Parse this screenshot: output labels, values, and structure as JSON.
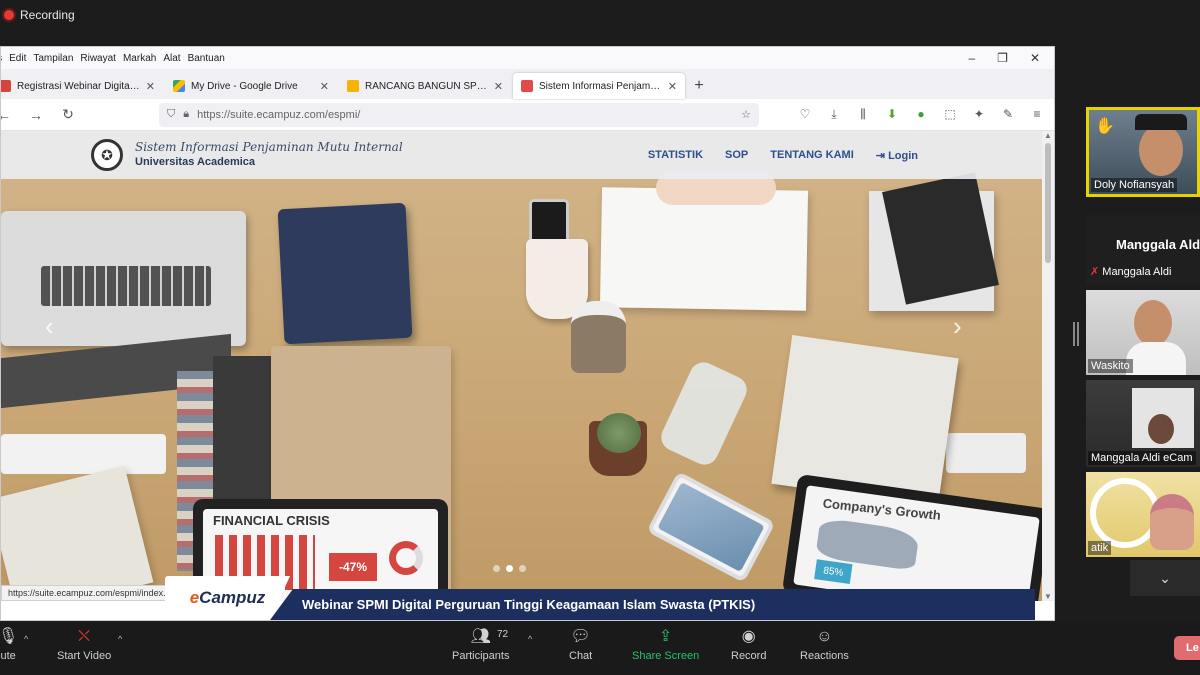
{
  "recording": {
    "label": "Recording"
  },
  "browser": {
    "menu": [
      "Berkas",
      "Edit",
      "Tampilan",
      "Riwayat",
      "Markah",
      "Alat",
      "Bantuan"
    ],
    "window_controls": [
      "–",
      "❐",
      "✕"
    ],
    "tabs": [
      {
        "title": "Registrasi Webinar Digitalisasi S",
        "favicon_color": "#d6453d",
        "active": false
      },
      {
        "title": "My Drive - Google Drive",
        "favicon_color": "#34a853",
        "active": false
      },
      {
        "title": "RANCANG BANGUN SPMI DIGI",
        "favicon_color": "#f4b400",
        "active": false
      },
      {
        "title": "Sistem Informasi Penjaminan M",
        "favicon_color": "#e24a4a",
        "active": true
      }
    ],
    "new_tab": "+",
    "url": "https://suite.ecampuz.com/espmi/",
    "status_url": "https://suite.ecampuz.com/espmi/index.php"
  },
  "site": {
    "title_line1": "Sistem Informasi Penjaminan Mutu Internal",
    "title_line2": "Universitas Academica",
    "nav": [
      "STATISTIK",
      "SOP",
      "TENTANG KAMI",
      "Login"
    ],
    "tablet1_title": "FINANCIAL CRISIS",
    "tablet1_pct": "-47%",
    "tablet2_title": "Company's Growth",
    "tablet2_pct": "85%",
    "carousel_prev": "‹",
    "carousel_next": "›"
  },
  "banner": {
    "logo_e": "e",
    "logo_rest": "Campuz",
    "text": "Webinar SPMI Digital Perguruan Tinggi Keagamaan Islam Swasta (PTKIS)"
  },
  "participants": {
    "tile1_name": "Doly Nofiansyah",
    "name_only_big": "Manggala Aldi",
    "name_only_small": "Manggala Aldi",
    "tile3_name": "Waskito",
    "tile4_name": "Manggala Aldi eCam",
    "tile5_name": "atik"
  },
  "toolbar": {
    "mute": "ute",
    "start_video": "Start Video",
    "participants": "Participants",
    "participants_count": "72",
    "chat": "Chat",
    "share_screen": "Share Screen",
    "record": "Record",
    "reactions": "Reactions",
    "leave": "Le"
  },
  "colors": {
    "banner_navy": "#1d2f5e",
    "ecampuz_orange": "#e35b1e",
    "share_green": "#27c26a",
    "speaker_highlight": "#e8d200"
  }
}
